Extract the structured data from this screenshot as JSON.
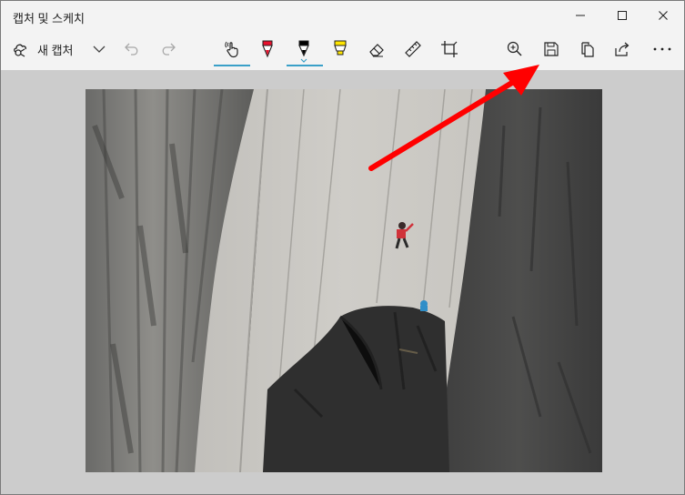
{
  "app": {
    "title": "캡처 및 스케치"
  },
  "window_controls": {
    "minimize_icon": "minimize-icon",
    "maximize_icon": "maximize-icon",
    "close_icon": "close-icon"
  },
  "toolbar": {
    "new_capture_label": "새 캡처",
    "tools": [
      {
        "name": "touch-writing",
        "icon": "touch-writing-icon",
        "active": true
      },
      {
        "name": "ballpoint-pen",
        "icon": "ballpoint-pen-icon",
        "color": "#e8112d"
      },
      {
        "name": "pencil",
        "icon": "pencil-icon",
        "color": "#000000",
        "active": true
      },
      {
        "name": "highlighter",
        "icon": "highlighter-icon",
        "color": "#ffe500"
      },
      {
        "name": "eraser",
        "icon": "eraser-icon"
      },
      {
        "name": "ruler",
        "icon": "ruler-icon"
      },
      {
        "name": "crop",
        "icon": "crop-icon"
      }
    ],
    "right_icons": [
      "zoom-in-icon",
      "save-icon",
      "copy-icon",
      "share-icon",
      "more-icon"
    ]
  },
  "annotation": {
    "arrow_color": "#ff0000"
  },
  "colors": {
    "accent": "#3aa0c8",
    "toolbar_bg": "#f3f3f3",
    "canvas_bg": "#cccccc"
  }
}
